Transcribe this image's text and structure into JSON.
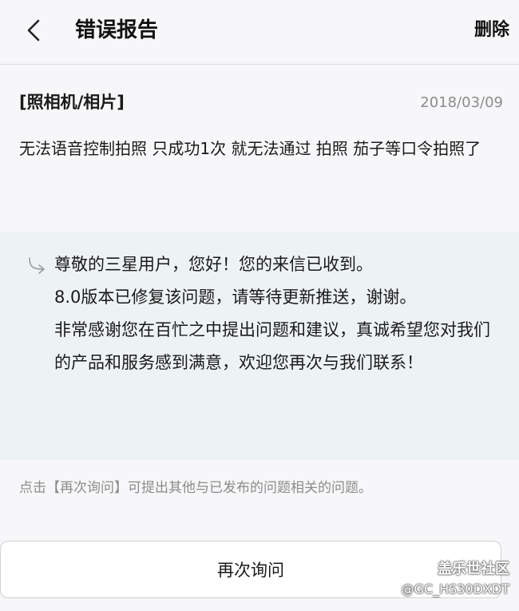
{
  "header": {
    "title": "错误报告",
    "delete_label": "删除"
  },
  "report": {
    "category": "[照相机/相片]",
    "date": "2018/03/09",
    "message": "无法语音控制拍照 只成功1次  就无法通过 拍照 茄子等口令拍照了"
  },
  "reply": {
    "lines": [
      "尊敬的三星用户，您好！您的来信已收到。",
      "8.0版本已修复该问题，请等待更新推送，谢谢。",
      "非常感谢您在百忙之中提出问题和建议，真诚希望您对我们的产品和服务感到满意，欢迎您再次与我们联系！"
    ]
  },
  "hint": "点击【再次询问】可提出其他与已发布的问题相关的问题。",
  "ask_again_label": "再次询问",
  "watermark": {
    "name": "盖乐世社区",
    "handle": "@GC_HS30DXDT"
  }
}
